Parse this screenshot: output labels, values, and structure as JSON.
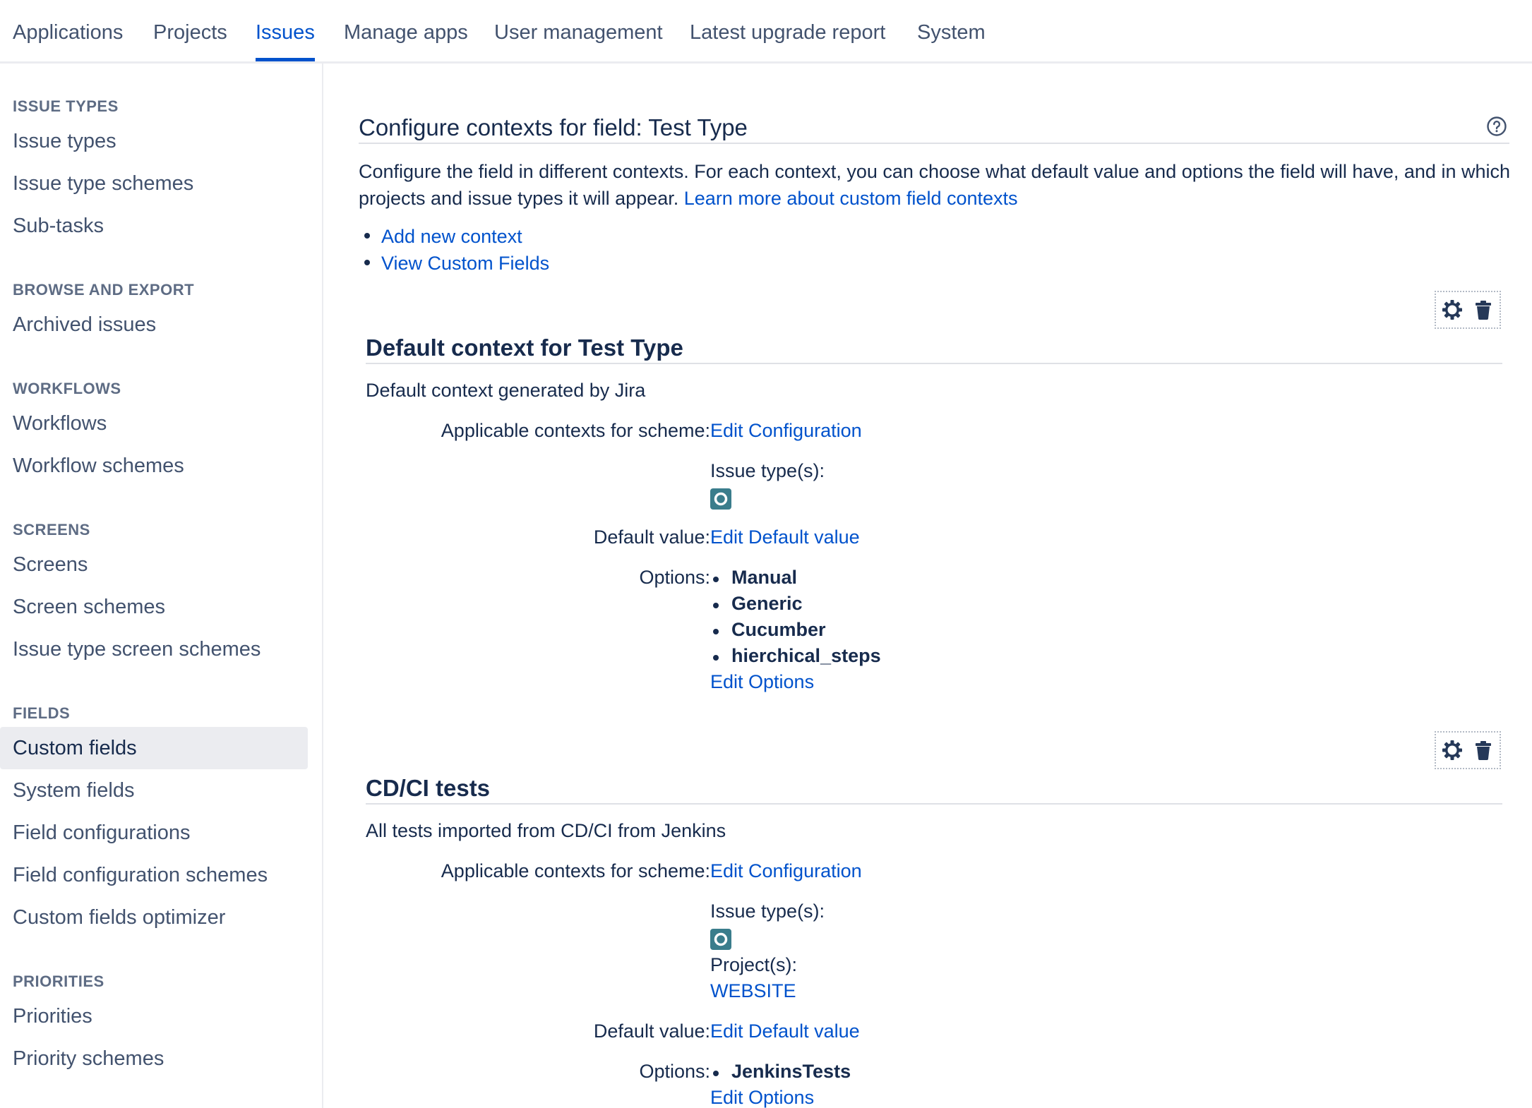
{
  "topnav": {
    "tabs": [
      {
        "label": "Applications"
      },
      {
        "label": "Projects"
      },
      {
        "label": "Issues",
        "active": true
      },
      {
        "label": "Manage apps"
      },
      {
        "label": "User management"
      },
      {
        "label": "Latest upgrade report"
      },
      {
        "label": "System"
      }
    ]
  },
  "sidebar": {
    "sections": [
      {
        "heading": "ISSUE TYPES",
        "items": [
          "Issue types",
          "Issue type schemes",
          "Sub-tasks"
        ]
      },
      {
        "heading": "BROWSE AND EXPORT",
        "items": [
          "Archived issues"
        ]
      },
      {
        "heading": "WORKFLOWS",
        "items": [
          "Workflows",
          "Workflow schemes"
        ]
      },
      {
        "heading": "SCREENS",
        "items": [
          "Screens",
          "Screen schemes",
          "Issue type screen schemes"
        ]
      },
      {
        "heading": "FIELDS",
        "items": [
          "Custom fields",
          "System fields",
          "Field configurations",
          "Field configuration schemes",
          "Custom fields optimizer"
        ]
      },
      {
        "heading": "PRIORITIES",
        "items": [
          "Priorities",
          "Priority schemes"
        ]
      }
    ],
    "selected_item": "Custom fields"
  },
  "main": {
    "title": "Configure contexts for field: Test Type",
    "help_icon": "question-circle-icon",
    "description": "Configure the field in different contexts. For each context, you can choose what default value and options the field will have, and in which projects and issue types it will appear.",
    "description_link": "Learn more about custom field contexts",
    "links": [
      "Add new context",
      "View Custom Fields"
    ],
    "contexts": [
      {
        "title": "Default context for Test Type",
        "description": "Default context generated by Jira",
        "applicable_label": "Applicable contexts for scheme:",
        "edit_configuration": "Edit Configuration",
        "issue_types_label": "Issue type(s):",
        "default_value_label": "Default value:",
        "edit_default_value": "Edit Default value",
        "options_label": "Options:",
        "options": [
          "Manual",
          "Generic",
          "Cucumber",
          "hierchical_steps"
        ],
        "edit_options": "Edit Options"
      },
      {
        "title": "CD/CI tests",
        "description": "All tests imported from CD/CI from Jenkins",
        "applicable_label": "Applicable contexts for scheme:",
        "edit_configuration": "Edit Configuration",
        "issue_types_label": "Issue type(s):",
        "projects_label": "Project(s):",
        "project": "WEBSITE",
        "default_value_label": "Default value:",
        "edit_default_value": "Edit Default value",
        "options_label": "Options:",
        "options": [
          "JenkinsTests"
        ],
        "edit_options": "Edit Options"
      }
    ]
  },
  "colors": {
    "link": "#0052cc",
    "text": "#172b4d",
    "selected_bg": "#ebecf0",
    "issue_type_icon": "#3a7d8c"
  }
}
